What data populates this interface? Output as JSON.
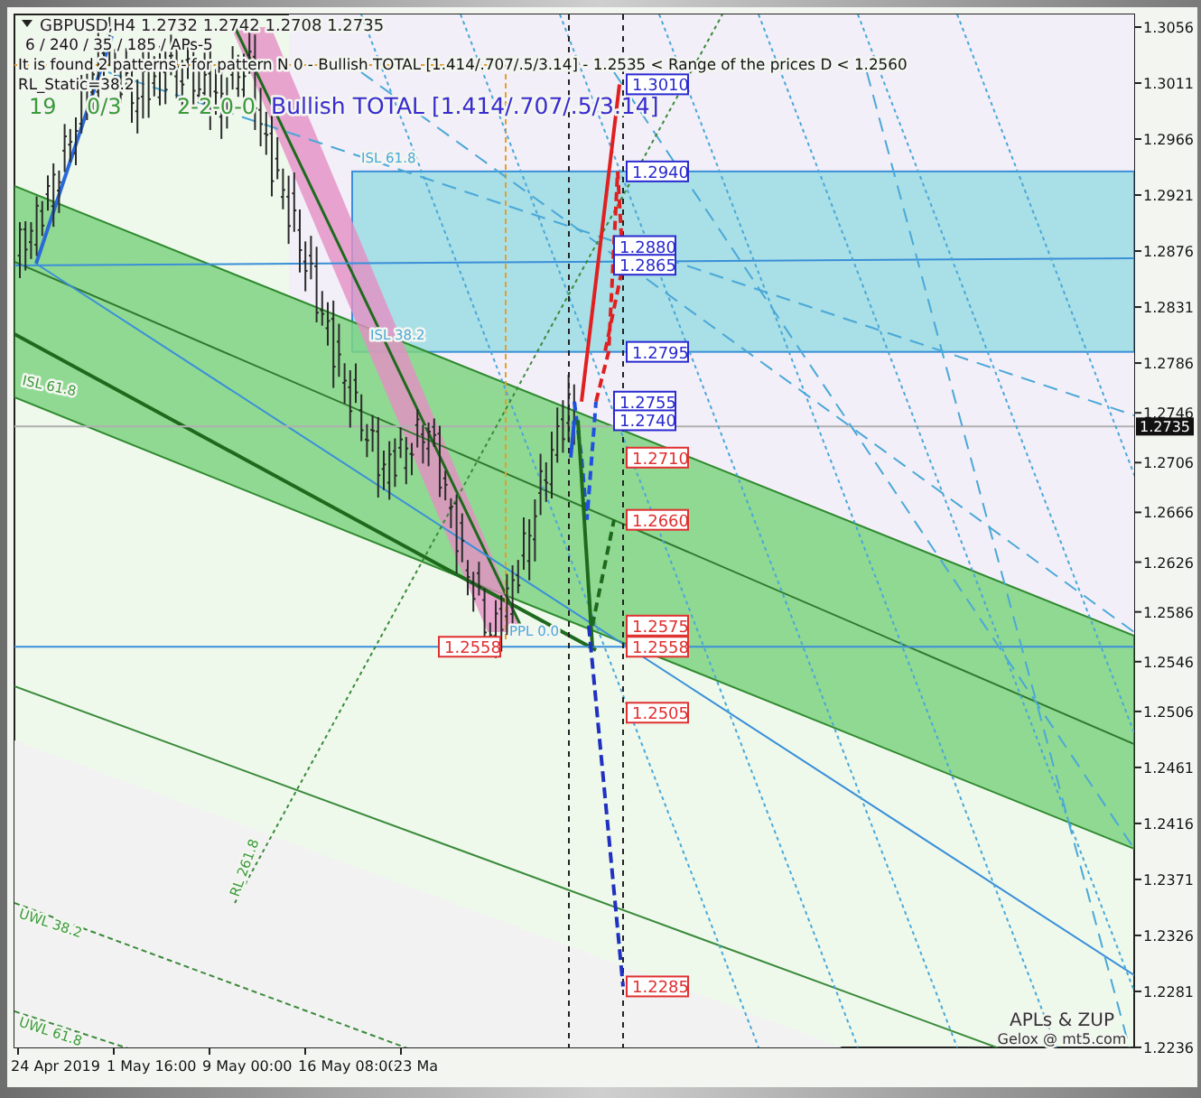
{
  "chart": {
    "symbol_line": "GBPUSD,H4  1.2732 1.2742 1.2708 1.2735",
    "info_lines": [
      "6 / 240 / 35 / 185 / APs-5",
      "It is found 2 patterns  -  for pattern N 0 - Bullish TOTAL [1.414/.707/.5/3.14] - 1.2535 < Range of the prices D < 1.2560",
      "RL_Static=38.2"
    ],
    "counters": [
      "19",
      "0/3",
      "2-2-0-0"
    ],
    "pattern_title": "Bullish TOTAL [1.414/.707/.5/3.14]",
    "level_labels": [
      "ISL 61.8",
      "ISL 38.2",
      "ISL 61.8",
      "RL 261.8",
      "UWL 38.2",
      "UWL 61.8",
      "PPL 0.0"
    ],
    "price_markers": [
      {
        "text": "1.3010",
        "color": "#2a2ad0",
        "kind": "projection"
      },
      {
        "text": "1.2940",
        "color": "#2a2ad0",
        "kind": "projection"
      },
      {
        "text": "1.2880",
        "color": "#2a2ad0",
        "kind": "projection"
      },
      {
        "text": "1.2865",
        "color": "#2a2ad0",
        "kind": "projection"
      },
      {
        "text": "1.2795",
        "color": "#2a2ad0",
        "kind": "projection"
      },
      {
        "text": "1.2755",
        "color": "#2a2ad0",
        "kind": "projection"
      },
      {
        "text": "1.2740",
        "color": "#2a2ad0",
        "kind": "projection"
      },
      {
        "text": "1.2710",
        "color": "#e03030",
        "kind": "projection"
      },
      {
        "text": "1.2660",
        "color": "#e03030",
        "kind": "projection"
      },
      {
        "text": "1.2575",
        "color": "#e03030",
        "kind": "projection"
      },
      {
        "text": "1.2558",
        "color": "#e03030",
        "kind": "projection"
      },
      {
        "text": "1.2505",
        "color": "#e03030",
        "kind": "projection"
      },
      {
        "text": "1.2285",
        "color": "#e03030",
        "kind": "projection"
      },
      {
        "text": "1.2558",
        "color": "#e03030",
        "kind": "pivot"
      }
    ],
    "current_price": "1.2735",
    "price_axis": [
      "1.3056",
      "1.3011",
      "1.2966",
      "1.2921",
      "1.2876",
      "1.2831",
      "1.2786",
      "1.2746",
      "1.2706",
      "1.2666",
      "1.2626",
      "1.2586",
      "1.2546",
      "1.2506",
      "1.2461",
      "1.2416",
      "1.2371",
      "1.2326",
      "1.2281",
      "1.2236"
    ],
    "time_axis": [
      "24 Apr 2019",
      "1 May 16:00",
      "9 May 00:00",
      "16 May 08:00",
      "23 Ma"
    ],
    "signature": [
      "APLs & ZUP",
      "Gelox @ mt5.com"
    ]
  }
}
